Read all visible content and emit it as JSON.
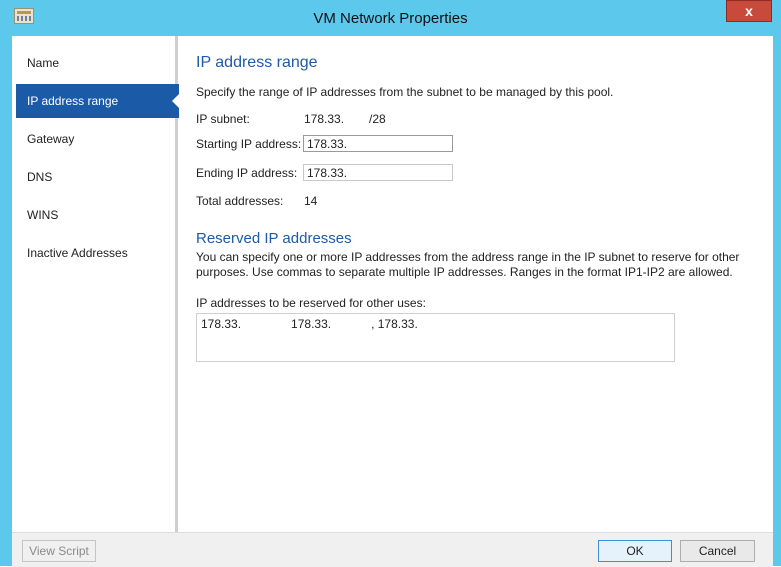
{
  "window": {
    "title": "VM Network Properties",
    "close_glyph": "x"
  },
  "sidebar": {
    "items": [
      {
        "label": "Name"
      },
      {
        "label": "IP address range"
      },
      {
        "label": "Gateway"
      },
      {
        "label": "DNS"
      },
      {
        "label": "WINS"
      },
      {
        "label": "Inactive Addresses"
      }
    ],
    "active_index": 1
  },
  "ip_range": {
    "heading": "IP address range",
    "description": "Specify the range of IP addresses from the subnet to be managed by this pool.",
    "subnet_label": "IP subnet:",
    "subnet_value": "178.33.",
    "subnet_suffix": "/28",
    "start_label": "Starting IP address:",
    "start_value": "178.33.",
    "end_label": "Ending IP address:",
    "end_value": "178.33.",
    "total_label": "Total addresses:",
    "total_value": "14"
  },
  "reserved": {
    "heading": "Reserved IP addresses",
    "description": "You can specify one or more IP addresses from the address range in the IP subnet to reserve for other purposes. Use commas to separate multiple IP addresses. Ranges in the format IP1-IP2 are allowed.",
    "field_label": "IP addresses to be reserved for other uses:",
    "field_value": "178.33.               178.33.            , 178.33."
  },
  "footer": {
    "view_script_label": "View Script",
    "ok_label": "OK",
    "cancel_label": "Cancel"
  },
  "colors": {
    "titlebar": "#5cc8ec",
    "accent": "#1e5aa8",
    "active_nav": "#1b5aa6",
    "close": "#c74a3a"
  }
}
